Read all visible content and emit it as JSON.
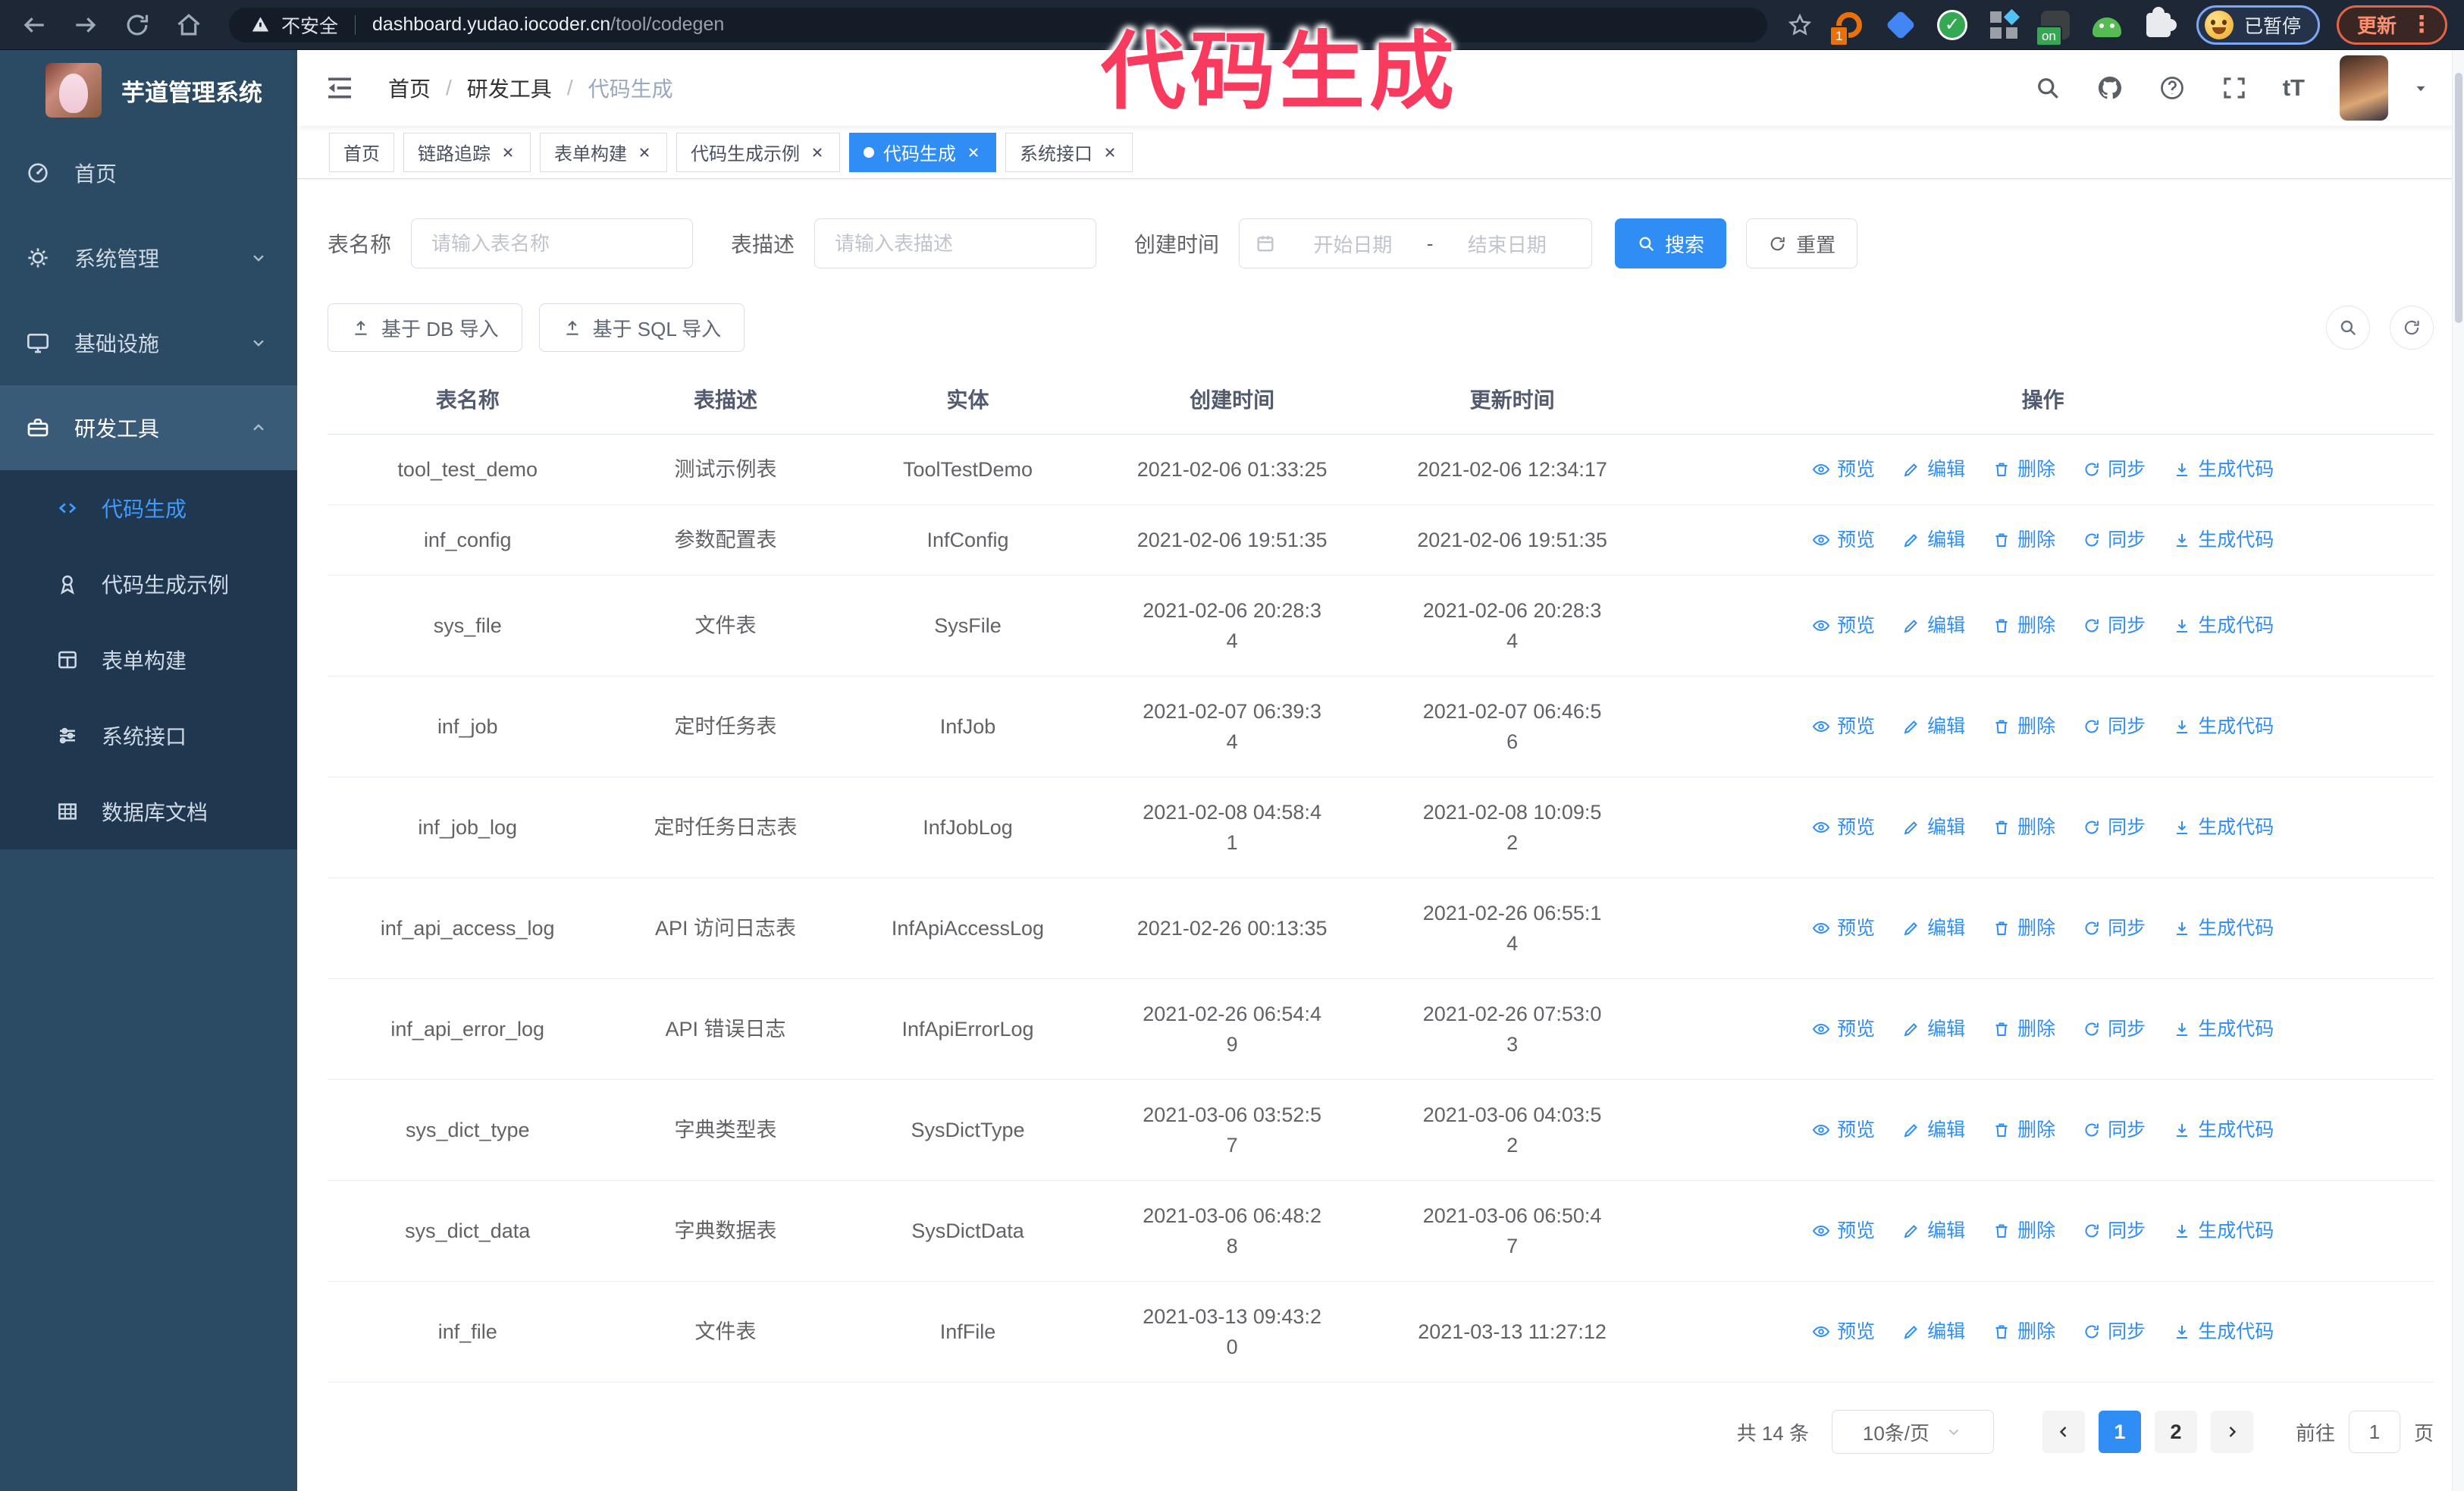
{
  "browser": {
    "security_label": "不安全",
    "url_host": "dashboard.yudao.iocoder.cn",
    "url_path": "/tool/codegen",
    "profile_chip_label": "已暂停",
    "update_label": "更新",
    "extensions": [
      {
        "name": "extension-circle-icon",
        "color": "#e8710a",
        "badge": "1"
      },
      {
        "name": "extension-gem-icon",
        "color": "#4285f4"
      },
      {
        "name": "extension-check-icon",
        "color": "#34a853"
      },
      {
        "name": "extension-grid-icon",
        "color": "#9aa0a6"
      },
      {
        "name": "extension-dark-icon",
        "color": "#3c4043",
        "badge": "on",
        "badge_color": "#34a853"
      },
      {
        "name": "extension-android-icon",
        "color": "#57bb54"
      },
      {
        "name": "extension-puzzle-icon",
        "color": "#e8eaed"
      }
    ]
  },
  "overlay": {
    "text": "代码生成"
  },
  "colors": {
    "primary": "#2f8df4",
    "link": "#2f8df4",
    "sidebar_bg": "#2b4a63",
    "submenu_bg": "#203750",
    "annotation_pink": "#f83a5e"
  },
  "sidebar": {
    "logo_title": "芋道管理系统",
    "items": [
      {
        "key": "home",
        "label": "首页",
        "icon": "dashboard-icon"
      },
      {
        "key": "system-management",
        "label": "系统管理",
        "icon": "gear-icon",
        "expandable": true,
        "expanded": false
      },
      {
        "key": "infrastructure",
        "label": "基础设施",
        "icon": "monitor-icon",
        "expandable": true,
        "expanded": false
      },
      {
        "key": "dev-tools",
        "label": "研发工具",
        "icon": "toolbox-icon",
        "expandable": true,
        "expanded": true,
        "active": true,
        "children": [
          {
            "key": "code-generation",
            "label": "代码生成",
            "icon": "code-icon",
            "active": true
          },
          {
            "key": "code-generation-example",
            "label": "代码生成示例",
            "icon": "example-icon"
          },
          {
            "key": "form-builder",
            "label": "表单构建",
            "icon": "form-build-icon"
          },
          {
            "key": "system-api",
            "label": "系统接口",
            "icon": "api-icon"
          },
          {
            "key": "database-doc",
            "label": "数据库文档",
            "icon": "db-doc-icon"
          }
        ]
      }
    ]
  },
  "header": {
    "breadcrumb": [
      "首页",
      "研发工具",
      "代码生成"
    ]
  },
  "tabs": [
    {
      "key": "home",
      "label": "首页",
      "closable": false,
      "active": false
    },
    {
      "key": "link-tracing",
      "label": "链路追踪",
      "closable": true,
      "active": false
    },
    {
      "key": "form-builder",
      "label": "表单构建",
      "closable": true,
      "active": false
    },
    {
      "key": "codegen-example",
      "label": "代码生成示例",
      "closable": true,
      "active": false
    },
    {
      "key": "codegen",
      "label": "代码生成",
      "closable": true,
      "active": true
    },
    {
      "key": "system-api",
      "label": "系统接口",
      "closable": true,
      "active": false
    }
  ],
  "filters": {
    "table_name_label": "表名称",
    "table_name_placeholder": "请输入表名称",
    "table_desc_label": "表描述",
    "table_desc_placeholder": "请输入表描述",
    "create_time_label": "创建时间",
    "start_placeholder": "开始日期",
    "range_separator": "-",
    "end_placeholder": "结束日期",
    "search_label": "搜索",
    "reset_label": "重置"
  },
  "toolbar": {
    "import_db_label": "基于 DB 导入",
    "import_sql_label": "基于 SQL 导入"
  },
  "table": {
    "columns": [
      "表名称",
      "表描述",
      "实体",
      "创建时间",
      "更新时间",
      "操作"
    ],
    "actions": [
      {
        "label": "预览",
        "icon": "eye-icon"
      },
      {
        "label": "编辑",
        "icon": "edit-icon"
      },
      {
        "label": "删除",
        "icon": "delete-icon"
      },
      {
        "label": "同步",
        "icon": "sync-icon"
      },
      {
        "label": "生成代码",
        "icon": "generate-code-icon"
      }
    ],
    "rows": [
      {
        "name": "tool_test_demo",
        "desc": "测试示例表",
        "entity": "ToolTestDemo",
        "created": "2021-02-06 01:33:25",
        "updated": "2021-02-06 12:34:17"
      },
      {
        "name": "inf_config",
        "desc": "参数配置表",
        "entity": "InfConfig",
        "created": "2021-02-06 19:51:35",
        "updated": "2021-02-06 19:51:35"
      },
      {
        "name": "sys_file",
        "desc": "文件表",
        "entity": "SysFile",
        "created": "2021-02-06 20:28:3\n4",
        "updated": "2021-02-06 20:28:3\n4"
      },
      {
        "name": "inf_job",
        "desc": "定时任务表",
        "entity": "InfJob",
        "created": "2021-02-07 06:39:3\n4",
        "updated": "2021-02-07 06:46:5\n6"
      },
      {
        "name": "inf_job_log",
        "desc": "定时任务日志表",
        "entity": "InfJobLog",
        "created": "2021-02-08 04:58:4\n1",
        "updated": "2021-02-08 10:09:5\n2"
      },
      {
        "name": "inf_api_access_log",
        "desc": "API 访问日志表",
        "entity": "InfApiAccessLog",
        "created": "2021-02-26 00:13:35",
        "updated": "2021-02-26 06:55:1\n4"
      },
      {
        "name": "inf_api_error_log",
        "desc": "API 错误日志",
        "entity": "InfApiErrorLog",
        "created": "2021-02-26 06:54:4\n9",
        "updated": "2021-02-26 07:53:0\n3"
      },
      {
        "name": "sys_dict_type",
        "desc": "字典类型表",
        "entity": "SysDictType",
        "created": "2021-03-06 03:52:5\n7",
        "updated": "2021-03-06 04:03:5\n2"
      },
      {
        "name": "sys_dict_data",
        "desc": "字典数据表",
        "entity": "SysDictData",
        "created": "2021-03-06 06:48:2\n8",
        "updated": "2021-03-06 06:50:4\n7"
      },
      {
        "name": "inf_file",
        "desc": "文件表",
        "entity": "InfFile",
        "created": "2021-03-13 09:43:2\n0",
        "updated": "2021-03-13 11:27:12"
      }
    ]
  },
  "pagination": {
    "total_label": "共 14 条",
    "page_size_label": "10条/页",
    "pages": [
      "1",
      "2"
    ],
    "active_page": "1",
    "goto_label": "前往",
    "goto_value": "1",
    "goto_suffix": "页"
  }
}
